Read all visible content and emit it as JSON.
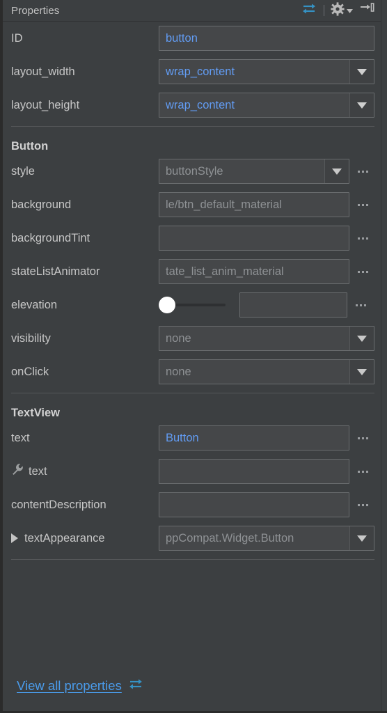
{
  "header": {
    "title": "Properties",
    "actions": [
      {
        "name": "toggle-expert-mode-icon",
        "glyph": "bidirectional-arrow-icon"
      },
      {
        "name": "separator",
        "glyph": "separator"
      },
      {
        "name": "settings-gear-icon",
        "glyph": "gear-dropdown-icon"
      },
      {
        "name": "collapse-panel-icon",
        "glyph": "hide-panel-icon"
      }
    ]
  },
  "sections": [
    {
      "id": "common",
      "title": null,
      "rows": [
        {
          "label": "ID",
          "control": "text",
          "value": "button",
          "value_style": "blue",
          "ellipsis": false,
          "width": "wide"
        },
        {
          "label": "layout_width",
          "control": "dropdown",
          "value": "wrap_content",
          "value_style": "blue",
          "ellipsis": false,
          "width": "wide"
        },
        {
          "label": "layout_height",
          "control": "dropdown",
          "value": "wrap_content",
          "value_style": "blue",
          "ellipsis": false,
          "width": "wide"
        }
      ]
    },
    {
      "id": "button",
      "title": "Button",
      "rows": [
        {
          "label": "style",
          "control": "dropdown",
          "value": "buttonStyle",
          "value_style": "muted",
          "ellipsis": true,
          "width": "narrow"
        },
        {
          "label": "background",
          "control": "text",
          "value": "le/btn_default_material",
          "value_style": "muted",
          "ellipsis": true,
          "width": "narrow"
        },
        {
          "label": "backgroundTint",
          "control": "text",
          "value": "",
          "value_style": "muted",
          "ellipsis": true,
          "width": "narrow"
        },
        {
          "label": "stateListAnimator",
          "control": "text",
          "value": "tate_list_anim_material",
          "value_style": "muted",
          "ellipsis": true,
          "width": "narrow"
        },
        {
          "label": "elevation",
          "control": "slider",
          "value": "",
          "slider_value": 0,
          "value_style": "muted",
          "ellipsis": true,
          "width": "slider"
        },
        {
          "label": "visibility",
          "control": "dropdown",
          "value": "none",
          "value_style": "muted",
          "ellipsis": false,
          "width": "wide"
        },
        {
          "label": "onClick",
          "control": "dropdown",
          "value": "none",
          "value_style": "muted",
          "ellipsis": false,
          "width": "wide"
        }
      ]
    },
    {
      "id": "textview",
      "title": "TextView",
      "rows": [
        {
          "label": "text",
          "control": "text",
          "value": "Button",
          "value_style": "blue",
          "ellipsis": true,
          "width": "narrow"
        },
        {
          "label": "text",
          "icon": "wrench-icon",
          "control": "text",
          "value": "",
          "value_style": "muted",
          "ellipsis": true,
          "width": "narrow"
        },
        {
          "label": "contentDescription",
          "control": "text",
          "value": "",
          "value_style": "muted",
          "ellipsis": true,
          "width": "narrow"
        },
        {
          "label": "textAppearance",
          "expander": true,
          "control": "dropdown",
          "value": "ppCompat.Widget.Button",
          "value_style": "muted",
          "ellipsis": false,
          "width": "wide"
        }
      ]
    }
  ],
  "footer": {
    "link_label": "View all properties",
    "link_icon": "bidirectional-arrow-icon"
  },
  "colors": {
    "panel_background": "#3c3f41",
    "field_background": "#454749",
    "field_border": "#6a6d6f",
    "accent_blue": "#629cf3",
    "link_blue": "#4a9bea",
    "label_text": "#c6c6c6",
    "muted_text": "#8e9194",
    "divider": "#555759"
  }
}
